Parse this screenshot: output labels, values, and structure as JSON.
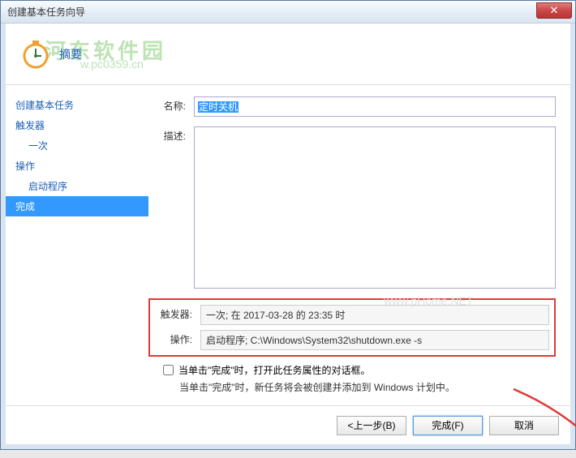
{
  "titlebar": {
    "title": "创建基本任务向导"
  },
  "header": {
    "subtitle": "摘要"
  },
  "watermarks": {
    "brand": "河东软件园",
    "url": "w.pc0359.cn",
    "center": "www.pHome.NET"
  },
  "sidebar": {
    "items": [
      {
        "label": "创建基本任务",
        "sub": false
      },
      {
        "label": "触发器",
        "sub": false
      },
      {
        "label": "一次",
        "sub": true
      },
      {
        "label": "操作",
        "sub": false
      },
      {
        "label": "启动程序",
        "sub": true
      },
      {
        "label": "完成",
        "sub": false,
        "selected": true
      }
    ]
  },
  "form": {
    "name_label": "名称:",
    "name_value": "定时关机",
    "desc_label": "描述:",
    "desc_value": "",
    "trigger_label": "触发器:",
    "trigger_value": "一次; 在 2017-03-28 的 23:35 时",
    "action_label": "操作:",
    "action_value": "启动程序; C:\\Windows\\System32\\shutdown.exe -s",
    "checkbox_label": "当单击\"完成\"时，打开此任务属性的对话框。",
    "note": "当单击\"完成\"时，新任务将会被创建并添加到 Windows 计划中。"
  },
  "footer": {
    "back": "<上一步(B)",
    "finish": "完成(F)",
    "cancel": "取消"
  }
}
